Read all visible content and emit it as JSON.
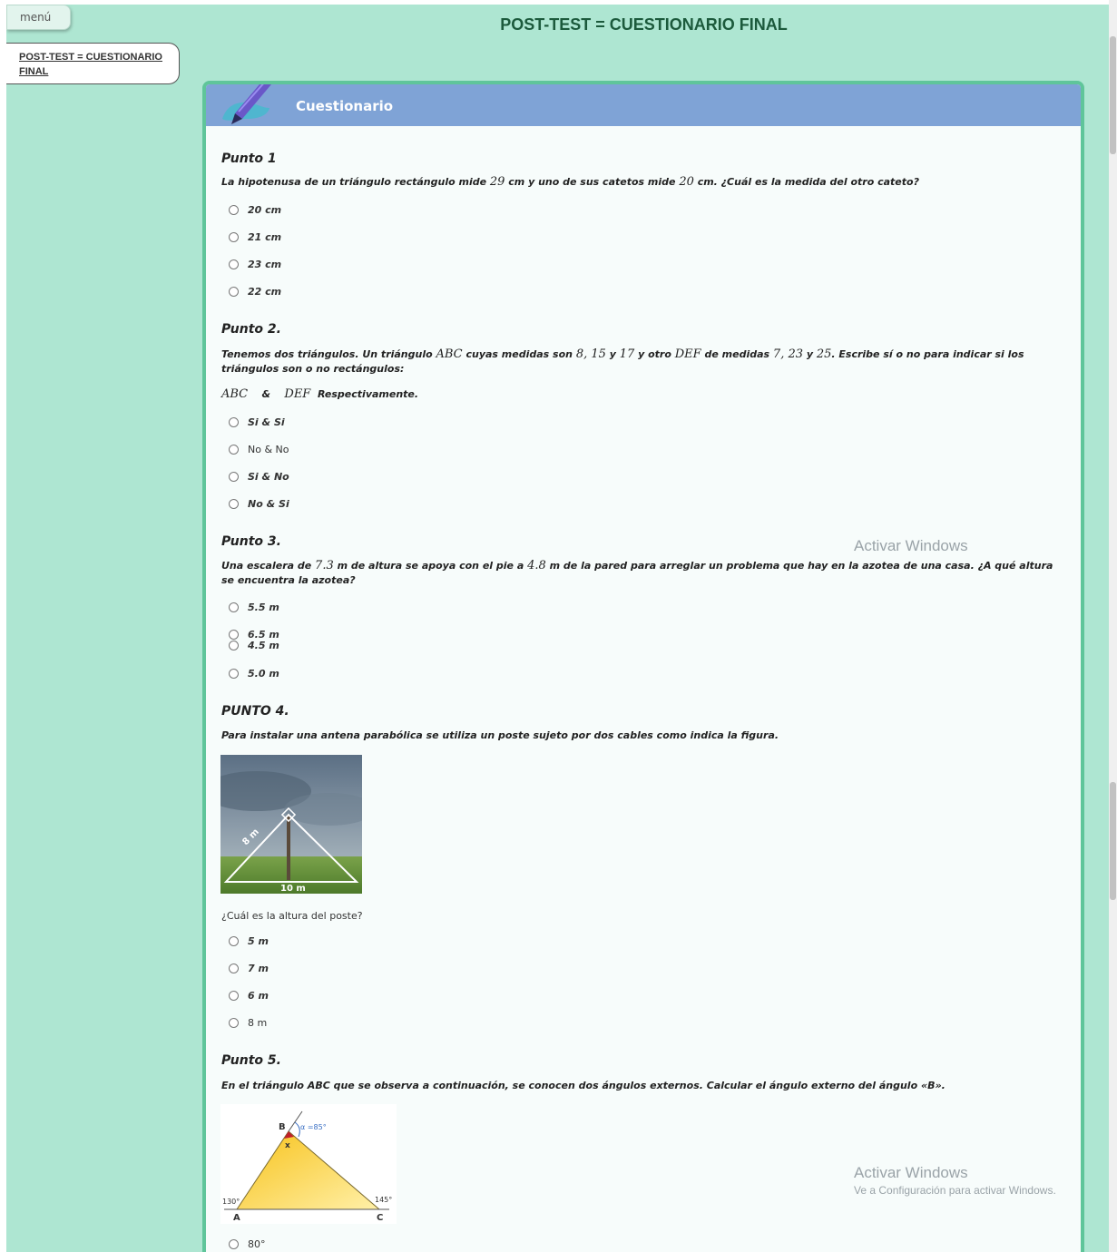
{
  "menu": {
    "label": "menú"
  },
  "toc": {
    "link": "POST-TEST = CUESTIONARIO FINAL"
  },
  "page": {
    "title": "POST-TEST = CUESTIONARIO FINAL"
  },
  "card": {
    "title": "Cuestionario",
    "icon": "pencil-icon"
  },
  "q1": {
    "title": "Punto 1",
    "text_a": "La hipotenusa de un triángulo rectángulo mide ",
    "m1": "29",
    "text_b": " cm y uno de sus catetos mide ",
    "m2": "20",
    "text_c": " cm. ¿Cuál es la medida del otro cateto?",
    "options": [
      "20 cm",
      "21 cm",
      "23 cm",
      "22 cm"
    ]
  },
  "q2": {
    "title": "Punto 2.",
    "text_a": "Tenemos dos triángulos. Un triángulo ",
    "m_abc": "ABC",
    "text_b": " cuyas medidas son ",
    "m_a": "8, 15",
    "text_c": " y ",
    "m_b": "17",
    "text_d": " y otro ",
    "m_def": "DEF",
    "text_e": " de medidas ",
    "m_c": "7, 23",
    "text_f": " y ",
    "m_d": "25",
    "text_g": ". Escribe sí o no para indicar si los triángulos son o no rectángulos:",
    "line2_abc": "ABC",
    "line2_amp": "&",
    "line2_def": "DEF",
    "line2_resp": "Respectivamente.",
    "options": [
      "Si & Si",
      "No & No",
      "Si & No",
      "No & Si"
    ]
  },
  "q3": {
    "title": "Punto 3.",
    "text_a": "Una escalera de ",
    "m1": "7.3",
    "text_b": " m de altura se apoya con el pie a ",
    "m2": "4.8",
    "text_c": " m de la pared para arreglar un problema que hay en la azotea de una casa. ¿A qué altura se encuentra la azotea?",
    "options": [
      "5.5 m",
      "6.5 m",
      "4.5 m",
      "5.0 m"
    ]
  },
  "q4": {
    "title": "PUNTO 4.",
    "text": "Para instalar una antena parabólica se utiliza un poste sujeto por dos cables como indica la figura.",
    "fig_label_side": "8 m",
    "fig_label_base": "10 m",
    "question": "¿Cuál es la altura del poste?",
    "options": [
      "5 m",
      "7 m",
      "6 m",
      "8 m"
    ]
  },
  "q5": {
    "title": "Punto 5.",
    "text": "En el triángulo ABC que se observa a continuación, se conocen dos ángulos externos. Calcular el ángulo externo del ángulo «B».",
    "fig_B": "B",
    "fig_x": "x",
    "fig_alpha": "α =85°",
    "fig_A": "A",
    "fig_C": "C",
    "fig_130": "130°",
    "fig_145": "145°",
    "options": [
      "80°"
    ]
  },
  "watermark": {
    "line1": "Activar Windows",
    "line2": "Ve a Configuración para activar Windows."
  }
}
